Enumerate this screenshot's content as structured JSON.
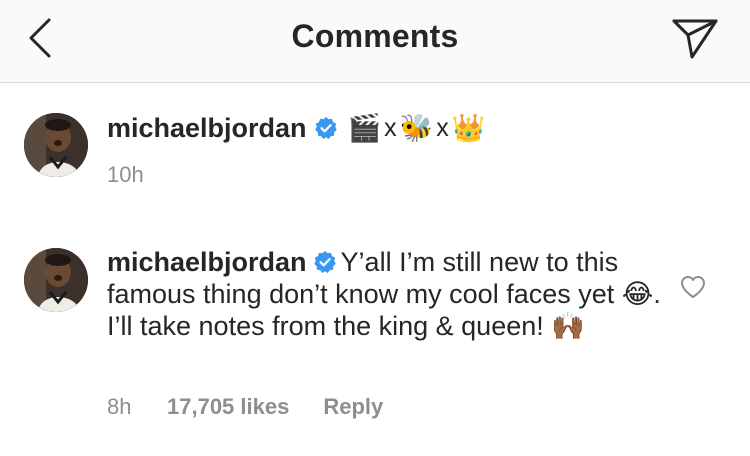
{
  "header": {
    "title": "Comments",
    "back_icon": "chevron-left-icon",
    "share_icon": "paper-plane-icon"
  },
  "caption": {
    "username": "michaelbjordan",
    "verified": true,
    "emojis": [
      "🎬",
      "x",
      "🐝",
      "x",
      "👑"
    ],
    "timestamp": "10h"
  },
  "comment": {
    "username": "michaelbjordan",
    "verified": true,
    "text_part1": "Y’all I’m still new to this famous thing don’t know my cool faces yet",
    "emoji1": "😂",
    "text_part2": ". I’ll take notes from the king & queen!",
    "emoji2": "🙌🏾",
    "time": "8h",
    "likes": "17,705 likes",
    "reply_label": "Reply"
  },
  "colors": {
    "text": "#262626",
    "muted": "#8e8e8e",
    "verified_blue": "#3897f0",
    "header_bg": "#fafafa",
    "divider": "#dbdbdb"
  }
}
